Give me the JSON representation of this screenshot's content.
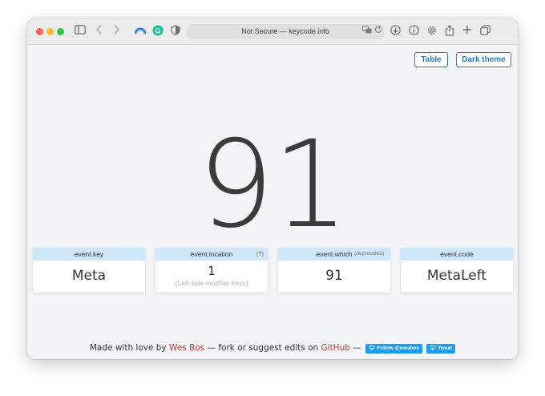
{
  "browser": {
    "address": "Not Secure — keycode.info"
  },
  "buttons": {
    "table": "Table",
    "dark_theme": "Dark theme"
  },
  "keycode": "91",
  "cards": [
    {
      "label": "event.key",
      "value": "Meta",
      "aux": "",
      "sub": ""
    },
    {
      "label": "event.location",
      "value": "1",
      "aux": "(?)",
      "sub": "(Left-side modifier keys)"
    },
    {
      "label": "event.which",
      "value": "91",
      "aux": "(deprecated)",
      "sub": ""
    },
    {
      "label": "event.code",
      "value": "MetaLeft",
      "aux": "",
      "sub": ""
    }
  ],
  "footer": {
    "made_with": "Made with love by",
    "author": "Wes Bos",
    "fork_text": "— fork or suggest edits on",
    "github": "GitHub",
    "dash": "—",
    "follow_button": "Follow @wesbos",
    "tweet_button": "Tweet"
  },
  "colors": {
    "accent": "#2f7eb6",
    "card_header": "#cfe7fb",
    "link": "#c8362e",
    "twitter": "#1d9bf0"
  },
  "icons": [
    "sidebar-icon",
    "back-icon",
    "forward-icon",
    "extension-icon",
    "grammarly-icon",
    "shield-icon",
    "translate-icon",
    "reload-icon",
    "download-icon",
    "info-icon",
    "gear-icon",
    "share-icon",
    "new-tab-icon",
    "tabs-icon",
    "twitter-bird-icon"
  ]
}
